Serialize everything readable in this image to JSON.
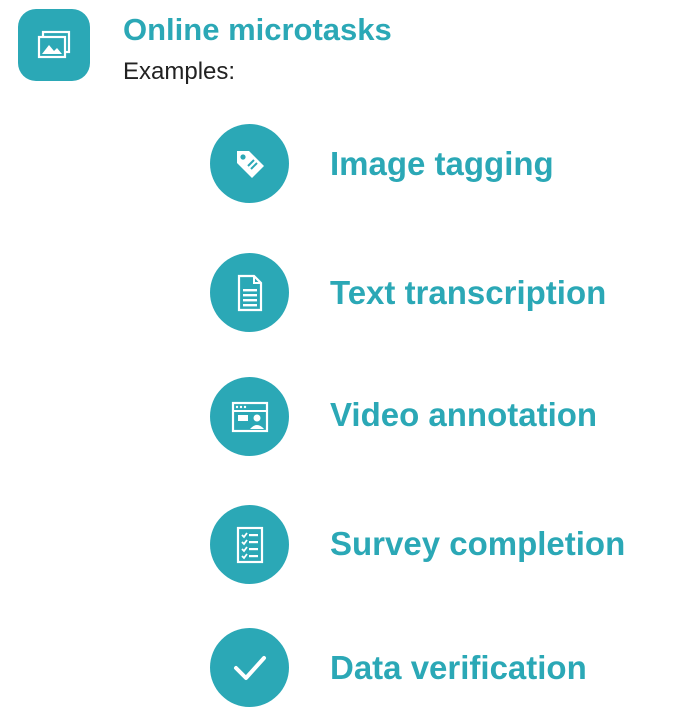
{
  "colors": {
    "accent": "#2ba8b6",
    "subtext": "#222222"
  },
  "header": {
    "icon": "image-gallery-icon",
    "title": "Online microtasks",
    "subtitle": "Examples:"
  },
  "items": [
    {
      "icon": "tag-icon",
      "label": "Image tagging"
    },
    {
      "icon": "document-icon",
      "label": "Text transcription"
    },
    {
      "icon": "video-window-icon",
      "label": "Video annotation"
    },
    {
      "icon": "checklist-icon",
      "label": "Survey completion"
    },
    {
      "icon": "checkmark-icon",
      "label": "Data verification"
    }
  ]
}
